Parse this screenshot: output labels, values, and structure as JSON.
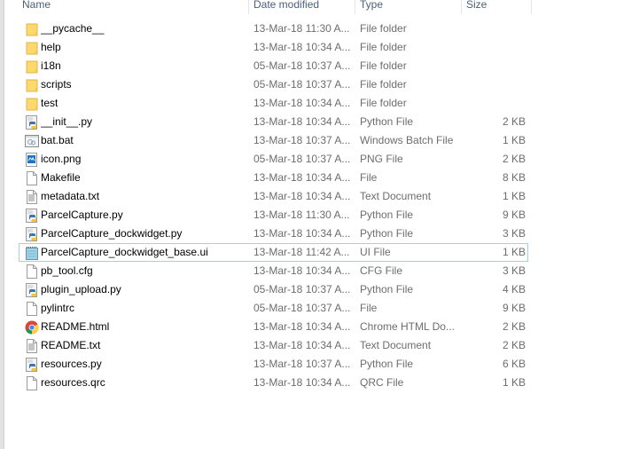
{
  "columns": {
    "name": "Name",
    "date_modified": "Date modified",
    "type": "Type",
    "size": "Size"
  },
  "files": [
    {
      "name": "__pycache__",
      "date": "13-Mar-18 11:30 A...",
      "type": "File folder",
      "size": "",
      "icon": "folder-icon"
    },
    {
      "name": "help",
      "date": "13-Mar-18 10:34 A...",
      "type": "File folder",
      "size": "",
      "icon": "folder-icon"
    },
    {
      "name": "i18n",
      "date": "05-Mar-18 10:37 A...",
      "type": "File folder",
      "size": "",
      "icon": "folder-icon"
    },
    {
      "name": "scripts",
      "date": "05-Mar-18 10:37 A...",
      "type": "File folder",
      "size": "",
      "icon": "folder-icon"
    },
    {
      "name": "test",
      "date": "13-Mar-18 10:34 A...",
      "type": "File folder",
      "size": "",
      "icon": "folder-icon"
    },
    {
      "name": "__init__.py",
      "date": "13-Mar-18 10:34 A...",
      "type": "Python File",
      "size": "2 KB",
      "icon": "python-file-icon"
    },
    {
      "name": "bat.bat",
      "date": "13-Mar-18 10:37 A...",
      "type": "Windows Batch File",
      "size": "1 KB",
      "icon": "batch-file-icon"
    },
    {
      "name": "icon.png",
      "date": "05-Mar-18 10:37 A...",
      "type": "PNG File",
      "size": "2 KB",
      "icon": "image-file-icon"
    },
    {
      "name": "Makefile",
      "date": "13-Mar-18 10:34 A...",
      "type": "File",
      "size": "8 KB",
      "icon": "blank-file-icon"
    },
    {
      "name": "metadata.txt",
      "date": "13-Mar-18 10:34 A...",
      "type": "Text Document",
      "size": "1 KB",
      "icon": "text-file-icon"
    },
    {
      "name": "ParcelCapture.py",
      "date": "13-Mar-18 11:30 A...",
      "type": "Python File",
      "size": "9 KB",
      "icon": "python-file-icon"
    },
    {
      "name": "ParcelCapture_dockwidget.py",
      "date": "13-Mar-18 10:34 A...",
      "type": "Python File",
      "size": "3 KB",
      "icon": "python-file-icon"
    },
    {
      "name": "ParcelCapture_dockwidget_base.ui",
      "date": "13-Mar-18 11:42 A...",
      "type": "UI File",
      "size": "1 KB",
      "icon": "notepad-file-icon",
      "selected": true
    },
    {
      "name": "pb_tool.cfg",
      "date": "13-Mar-18 10:34 A...",
      "type": "CFG File",
      "size": "3 KB",
      "icon": "blank-file-icon"
    },
    {
      "name": "plugin_upload.py",
      "date": "05-Mar-18 10:37 A...",
      "type": "Python File",
      "size": "4 KB",
      "icon": "python-file-icon"
    },
    {
      "name": "pylintrc",
      "date": "05-Mar-18 10:37 A...",
      "type": "File",
      "size": "9 KB",
      "icon": "blank-file-icon"
    },
    {
      "name": "README.html",
      "date": "13-Mar-18 10:34 A...",
      "type": "Chrome HTML Do...",
      "size": "2 KB",
      "icon": "chrome-icon"
    },
    {
      "name": "README.txt",
      "date": "13-Mar-18 10:34 A...",
      "type": "Text Document",
      "size": "2 KB",
      "icon": "text-file-icon"
    },
    {
      "name": "resources.py",
      "date": "13-Mar-18 10:37 A...",
      "type": "Python File",
      "size": "6 KB",
      "icon": "python-file-icon"
    },
    {
      "name": "resources.qrc",
      "date": "13-Mar-18 10:34 A...",
      "type": "QRC File",
      "size": "1 KB",
      "icon": "blank-file-icon"
    }
  ],
  "colors": {
    "selection_border": "#99d1ff",
    "header_text": "#4c607a",
    "secondary_text": "#6d6d6d",
    "folder": "#ffd96b"
  }
}
